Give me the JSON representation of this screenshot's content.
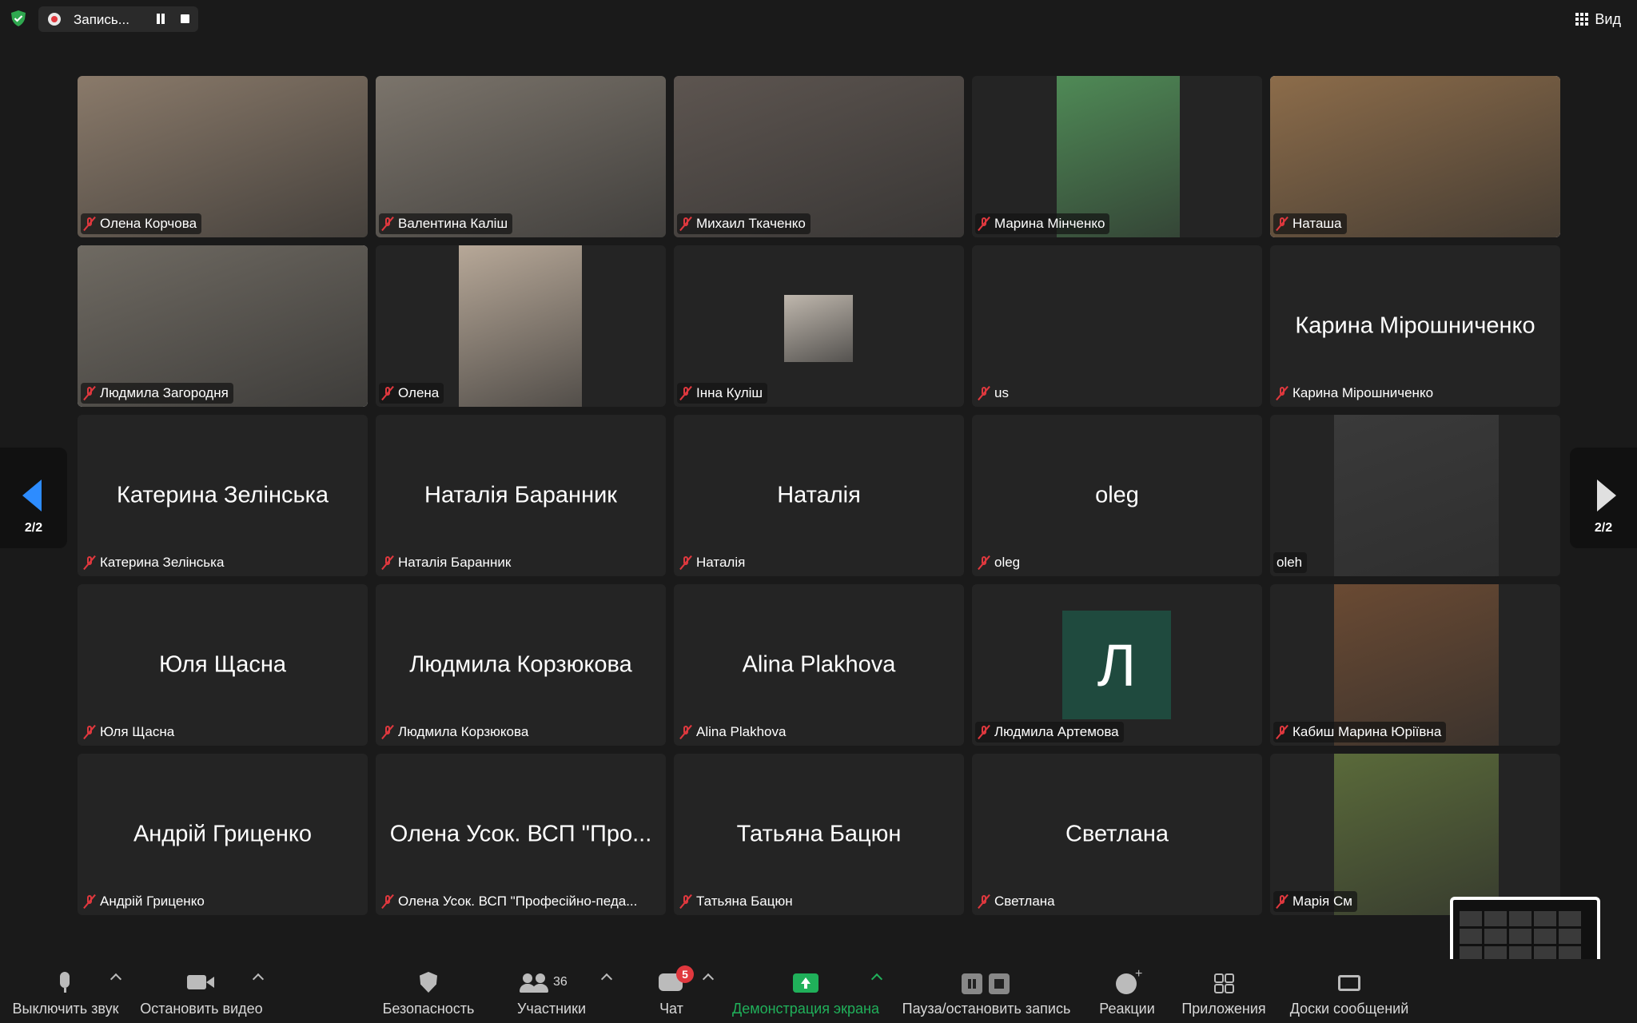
{
  "topbar": {
    "recording_label": "Запись...",
    "view_label": "Вид"
  },
  "pagination": {
    "left": "2/2",
    "right": "2/2"
  },
  "tiles": [
    {
      "name": "Олена Корчова",
      "big": "",
      "muted": true,
      "video": "#8a7a6a"
    },
    {
      "name": "Валентина Каліш",
      "big": "",
      "muted": true,
      "video": "#7b746b"
    },
    {
      "name": "Михаил Ткаченко",
      "big": "",
      "muted": true,
      "video": "#5d5550"
    },
    {
      "name": "Марина Мінченко",
      "big": "",
      "muted": true,
      "video": "#4f8a56"
    },
    {
      "name": "Наташа",
      "big": "",
      "muted": true,
      "video": "#8c6c4a"
    },
    {
      "name": "Людмила Загородня",
      "big": "",
      "muted": true,
      "video": "#6f6a62"
    },
    {
      "name": "Олена",
      "big": "",
      "muted": true,
      "video": "#b7a898"
    },
    {
      "name": "Інна Куліш",
      "big": "",
      "muted": true,
      "video": "#bfb7ad"
    },
    {
      "name": "us",
      "big": "",
      "muted": true,
      "video": ""
    },
    {
      "name": "Карина Мірошниченко",
      "big": "Карина Мірошниченко",
      "muted": true,
      "video": ""
    },
    {
      "name": "Катерина Зелінська",
      "big": "Катерина Зелінська",
      "muted": true,
      "video": ""
    },
    {
      "name": "Наталія Баранник",
      "big": "Наталія Баранник",
      "muted": true,
      "video": ""
    },
    {
      "name": "Наталія",
      "big": "Наталія",
      "muted": true,
      "video": ""
    },
    {
      "name": "oleg",
      "big": "oleg",
      "muted": true,
      "video": ""
    },
    {
      "name": "oleh",
      "big": "",
      "muted": false,
      "video": "#3a3a3a"
    },
    {
      "name": "Юля Щасна",
      "big": "Юля Щасна",
      "muted": true,
      "video": ""
    },
    {
      "name": "Людмила Корзюкова",
      "big": "Людмила Корзюкова",
      "muted": true,
      "video": ""
    },
    {
      "name": "Alina Plakhova",
      "big": "Alina Plakhova",
      "muted": true,
      "video": ""
    },
    {
      "name": "Людмила Артемова",
      "big": "",
      "muted": true,
      "video": "",
      "avatar_letter": "Л"
    },
    {
      "name": "Кабиш Марина Юріївна",
      "big": "",
      "muted": true,
      "video": "#6a4a33"
    },
    {
      "name": "Андрій Гриценко",
      "big": "Андрій Гриценко",
      "muted": true,
      "video": ""
    },
    {
      "name": "Олена Усок. ВСП \"Професійно-педа...",
      "big": "Олена Усок. ВСП \"Про...",
      "muted": true,
      "video": ""
    },
    {
      "name": "Татьяна Бацюн",
      "big": "Татьяна Бацюн",
      "muted": true,
      "video": ""
    },
    {
      "name": "Светлана",
      "big": "Светлана",
      "muted": true,
      "video": ""
    },
    {
      "name": "Марія См",
      "big": "",
      "muted": true,
      "video": "#5a6a3a"
    }
  ],
  "toolbar": {
    "mute": "Выключить звук",
    "stop_video": "Остановить видео",
    "security": "Безопасность",
    "participants": "Участники",
    "participants_count": "36",
    "chat": "Чат",
    "chat_badge": "5",
    "share": "Демонстрация экрана",
    "pause_record": "Пауза/остановить запись",
    "reactions": "Реакции",
    "apps": "Приложения",
    "whiteboards": "Доски сообщений"
  },
  "colors": {
    "share_green": "#20b05a",
    "mute_red": "#e0383e",
    "nav_blue": "#2d8cff",
    "avatar_bg": "#1f4a3e"
  }
}
